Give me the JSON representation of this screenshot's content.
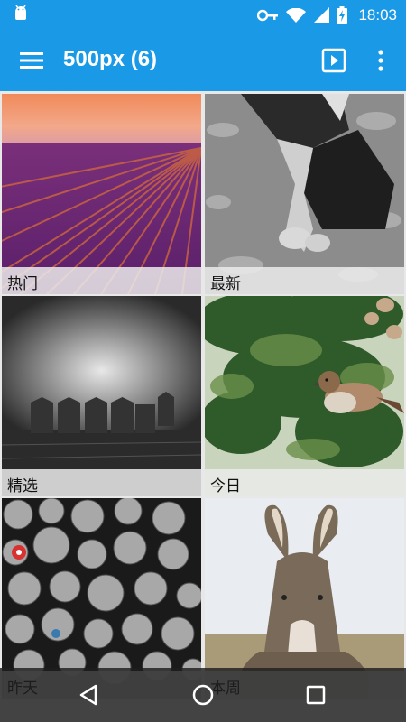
{
  "status_bar": {
    "time": "18:03",
    "icons": [
      "android-icon",
      "key-icon",
      "wifi-icon",
      "signal-icon",
      "battery-charging-icon"
    ]
  },
  "app_bar": {
    "title": "500px (6)",
    "icons": [
      "menu-icon",
      "slideshow-play-icon",
      "more-vert-icon"
    ],
    "color": "#1a9ae6"
  },
  "tiles": [
    {
      "label": "热门",
      "photo": "lavender-field-sunset"
    },
    {
      "label": "最新",
      "photo": "bw-person-kneeling-hands-sand"
    },
    {
      "label": "精选",
      "photo": "bw-grain-silos-foggy"
    },
    {
      "label": "今日",
      "photo": "sparrow-in-pine-branches"
    },
    {
      "label": "昨天",
      "photo": "bw-stacked-log-ends"
    },
    {
      "label": "本周",
      "photo": "donkey-portrait"
    }
  ],
  "nav_bar": {
    "icons": [
      "back-icon",
      "home-icon",
      "recents-icon"
    ]
  }
}
